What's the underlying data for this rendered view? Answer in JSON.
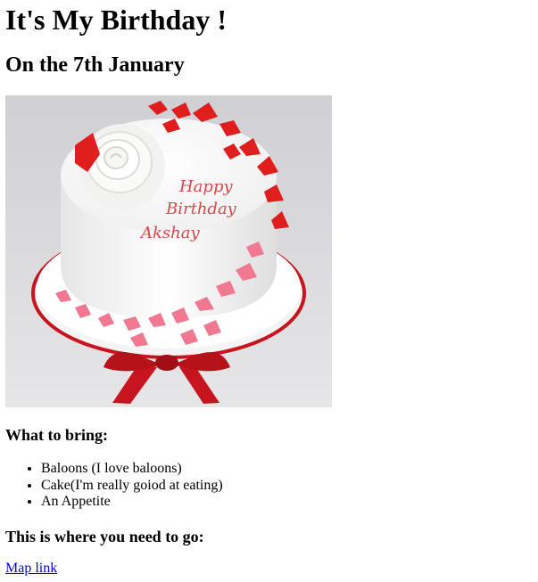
{
  "page": {
    "title": "It's My Birthday !",
    "subtitle": "On the 7th January"
  },
  "image": {
    "icon": "birthday-cake-image",
    "inscription": [
      "Happy",
      "Birthday",
      "Akshay"
    ],
    "colors": {
      "background": "#d8d8dc",
      "cake": "#ffffff",
      "butterfly_red": "#e01e1e",
      "butterfly_pink": "#f07890",
      "ribbon": "#c8141e",
      "text": "#d84848"
    }
  },
  "bring": {
    "heading": "What to bring:",
    "items": [
      "Baloons (I love baloons)",
      "Cake(I'm really goiod at eating)",
      "An Appetite"
    ]
  },
  "location": {
    "heading": "This is where you need to go:",
    "link_label": "Map link"
  }
}
